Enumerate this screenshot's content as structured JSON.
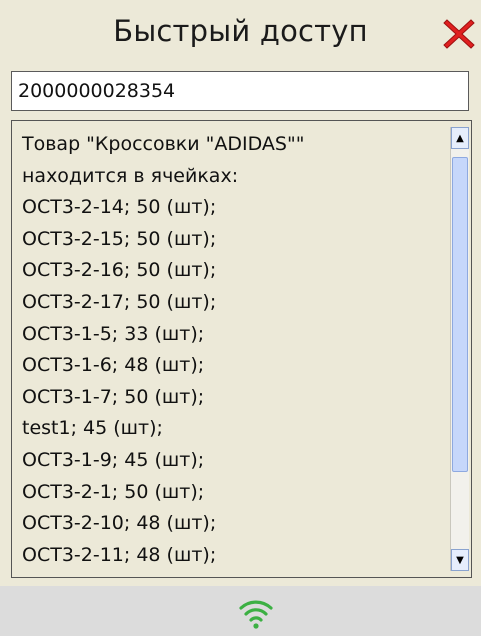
{
  "header": {
    "title": "Быстрый доступ"
  },
  "search": {
    "value": "2000000028354"
  },
  "results": {
    "lines": [
      "Товар \"Кроссовки \"ADIDAS\"\"",
      "находится в ячейках:",
      "ОСТ3-2-14; 50 (шт);",
      "ОСТ3-2-15; 50 (шт);",
      "ОСТ3-2-16; 50 (шт);",
      "ОСТ3-2-17; 50 (шт);",
      "ОСТ3-1-5; 33 (шт);",
      "ОСТ3-1-6; 48 (шт);",
      "ОСТ3-1-7; 50 (шт);",
      "test1; 45 (шт);",
      "ОСТ3-1-9; 45 (шт);",
      "ОСТ3-2-1; 50 (шт);",
      "ОСТ3-2-10; 48 (шт);",
      "ОСТ3-2-11; 48 (шт);"
    ]
  },
  "icons": {
    "close": "close-icon",
    "scroll_up": "scroll-up-arrow-icon",
    "scroll_down": "scroll-down-arrow-icon",
    "wifi": "wifi-icon"
  },
  "colors": {
    "background": "#ece9d8",
    "close_red": "#e02020",
    "wifi_green": "#3cb043",
    "bottom_bar": "#dcdcdc"
  }
}
